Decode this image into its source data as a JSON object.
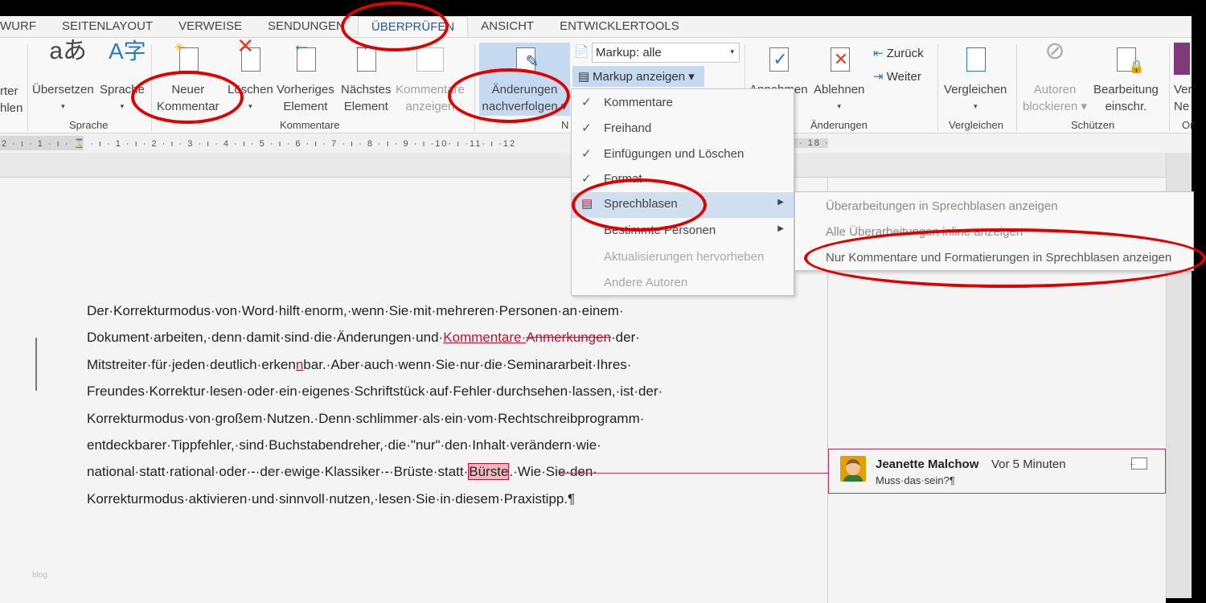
{
  "tabs": [
    "WURF",
    "SEITENLAYOUT",
    "VERWEISE",
    "SENDUNGEN",
    "ÜBERPRÜFEN",
    "ANSICHT",
    "ENTWICKLERTOOLS"
  ],
  "ribbon": {
    "partial_left": [
      "rter",
      "hlen"
    ],
    "uebersetzen": "Übersetzen",
    "sprache": "Sprache",
    "neuer": [
      "Neuer",
      "Kommentar"
    ],
    "loeschen": "Löschen",
    "vorheriges": [
      "Vorheriges",
      "Element"
    ],
    "naechstes": [
      "Nächstes",
      "Element"
    ],
    "anzeigen": [
      "Kommentare",
      "anzeigen"
    ],
    "nachverfolgen": [
      "Änderungen",
      "nachverfolgen ▾"
    ],
    "markup_select": "Markup: alle",
    "markup_show": "Markup anzeigen ▾",
    "annehmen": "Annehmen",
    "ablehnen": "Ablehnen",
    "zurueck": "Zurück",
    "weiter": "Weiter",
    "vergleichen": "Vergleichen",
    "autoren": [
      "Autoren",
      "blockieren ▾"
    ],
    "bearbeitung": [
      "Bearbeitung",
      "einschr."
    ],
    "partial_right": [
      "Ver",
      "Ne"
    ],
    "groups": {
      "sprache": "Sprache",
      "kommentare": "Kommentare",
      "nachverfolgung": "N",
      "aenderungen": "Änderungen",
      "vergleichen": "Vergleichen",
      "schuetzen": "Schützen",
      "partial": "Or"
    }
  },
  "ruler": "2 · ı · 1 · ı · ⌛ · ı · 1 · ı · 2 · ı · 3 · ı · 4 · ı · 5 · ı · 6 · ı · 7 · ı · 8 · ı · 9 · ı ·10· ı ·11· ı ·12",
  "ruler_end": "· 18 ·",
  "menu": {
    "items": [
      {
        "label": "Kommentare",
        "checked": true
      },
      {
        "label": "Freihand",
        "checked": true
      },
      {
        "label": "Einfügungen und Löschen",
        "checked": true
      },
      {
        "label": "Format",
        "checked": true
      },
      {
        "label": "Sprechblasen",
        "submenu": true
      },
      {
        "label": "Bestimmte Personen",
        "submenu": true
      },
      {
        "label": "Aktualisierungen hervorheben",
        "disabled": true
      },
      {
        "label": "Andere Autoren",
        "disabled": true
      }
    ]
  },
  "submenu": [
    "Überarbeitungen in Sprechblasen anzeigen",
    "Alle Überarbeitungen inline anzeigen",
    "Nur Kommentare und Formatierungen in Sprechblasen anzeigen"
  ],
  "document": {
    "l1": "Der·Korrekturmodus·von·Word·hilft·enorm,·wenn·Sie·mit·mehreren·Personen·an·einem·",
    "l2a": "Dokument·arbeiten,·denn·damit·sind·die·Änderungen·und·",
    "l2ins": "Kommentare·",
    "l2del": "Anmerkungen",
    "l2b": "·der·",
    "l3a": "Mitstreiter·für·jeden·deutlich·erken",
    "l3ins": "n",
    "l3b": "bar.·Aber·auch·wenn·Sie·nur·die·Seminararbeit·Ihres·",
    "l4": "Freundes·Korrektur·lesen·oder·ein·eigenes·Schriftstück·auf·Fehler·durchsehen·lassen,·ist·der·",
    "l5": "Korrekturmodus·von·großem·Nutzen.·Denn·schlimmer·als·ein·vom·Rechtschreibprogramm·",
    "l6": "entdeckbarer·Tippfehler,·sind·Buchstabendreher,·die·\"nur\"·den·Inhalt·verändern·wie·",
    "l7a": "national·statt·rational·oder·-·der·ewige·Klassiker·-·Brüste·statt·",
    "l7hl": "Bürste",
    "l7b": ".·Wie·Sie·den·",
    "l8": "Korrekturmodus·aktivieren·und·sinnvoll·nutzen,·lesen·Sie·in·diesem·Praxistipp.¶",
    "watermark": "blog"
  },
  "comment": {
    "author": "Jeanette Malchow",
    "time": "Vor 5 Minuten",
    "text": "Muss·das·sein?¶"
  },
  "colors": {
    "accent": "#2b579a",
    "markup": "#c8102e",
    "highlight": "#cfdff0",
    "annotation": "#e00000"
  }
}
